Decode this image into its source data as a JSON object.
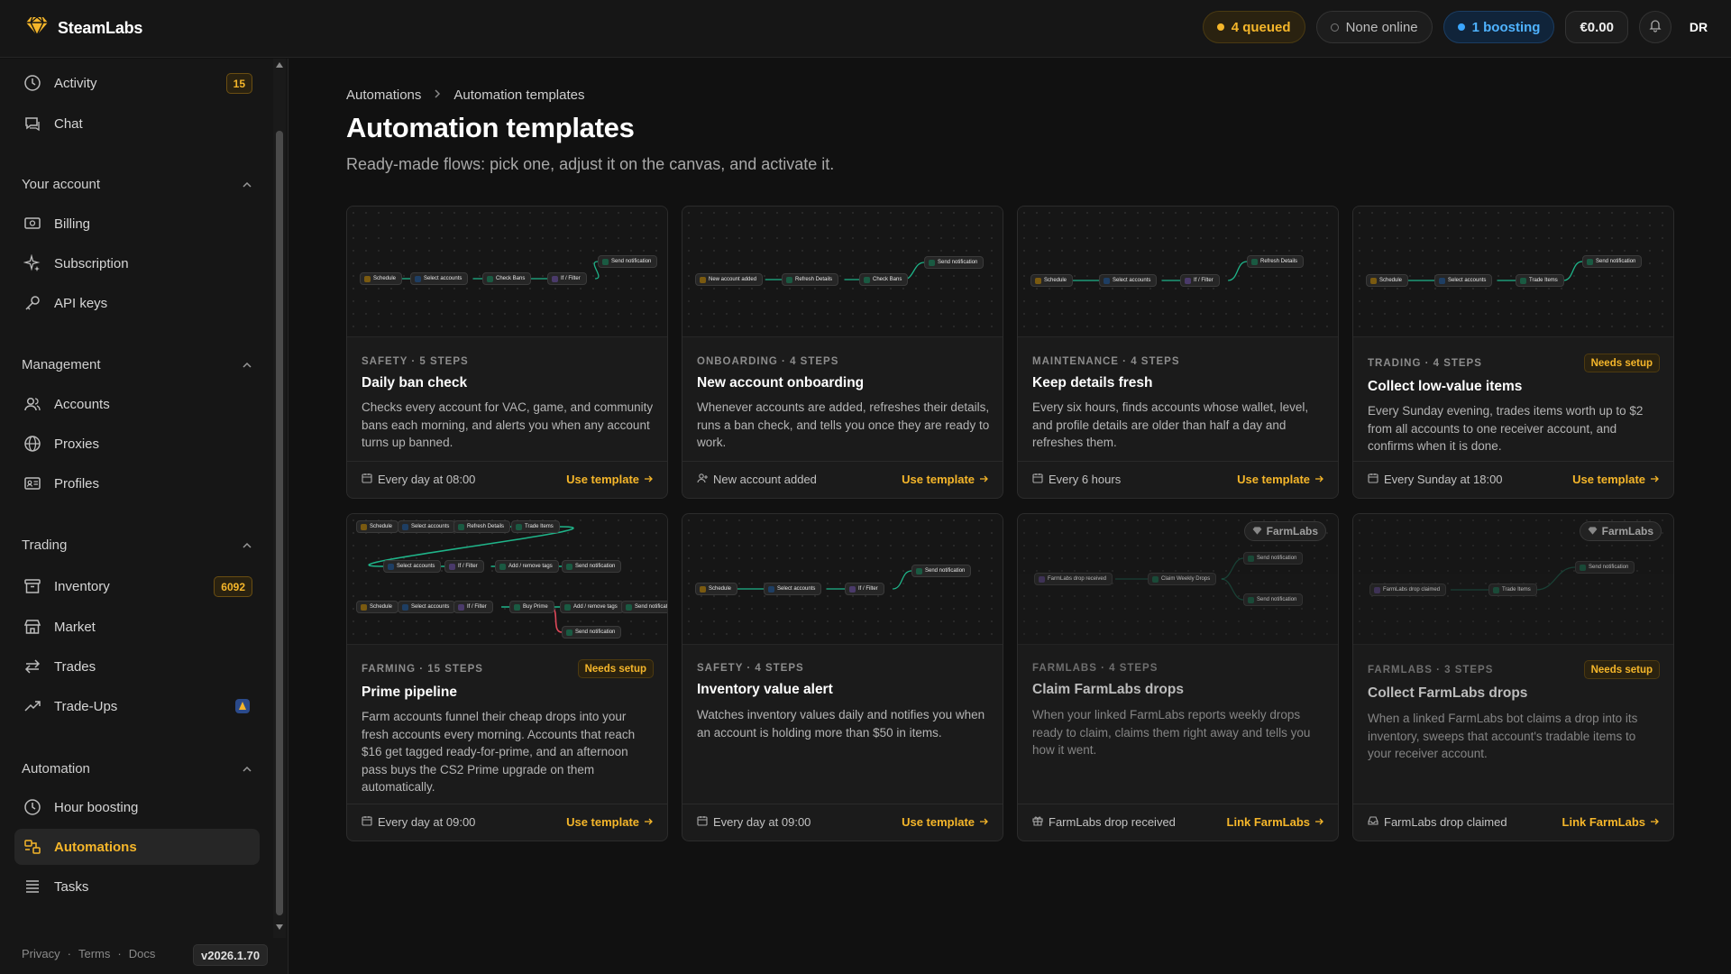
{
  "brand": {
    "name": "SteamLabs",
    "logo_icon": "diamond-logo-icon"
  },
  "topbar": {
    "queued": "4 queued",
    "online": "None online",
    "boosting": "1 boosting",
    "balance": "€0.00",
    "avatar_initials": "DR"
  },
  "sidebar": {
    "top_items": [
      {
        "label": "Activity",
        "icon": "clock-icon",
        "badge": "15"
      },
      {
        "label": "Chat",
        "icon": "chat-icon"
      }
    ],
    "sections": [
      {
        "title": "Your account",
        "items": [
          {
            "label": "Billing",
            "icon": "billing-icon"
          },
          {
            "label": "Subscription",
            "icon": "sparkle-icon"
          },
          {
            "label": "API keys",
            "icon": "key-icon"
          }
        ]
      },
      {
        "title": "Management",
        "items": [
          {
            "label": "Accounts",
            "icon": "users-icon"
          },
          {
            "label": "Proxies",
            "icon": "globe-icon"
          },
          {
            "label": "Profiles",
            "icon": "id-card-icon"
          }
        ]
      },
      {
        "title": "Trading",
        "items": [
          {
            "label": "Inventory",
            "icon": "archive-icon",
            "badge": "6092"
          },
          {
            "label": "Market",
            "icon": "store-icon"
          },
          {
            "label": "Trades",
            "icon": "swap-icon"
          },
          {
            "label": "Trade-Ups",
            "icon": "trending-up-icon"
          }
        ]
      },
      {
        "title": "Automation",
        "items": [
          {
            "label": "Hour boosting",
            "icon": "clock-icon"
          },
          {
            "label": "Automations",
            "icon": "automation-icon",
            "active": true
          },
          {
            "label": "Tasks",
            "icon": "list-icon"
          }
        ]
      }
    ],
    "footer": {
      "privacy": "Privacy",
      "terms": "Terms",
      "docs": "Docs",
      "version": "v2026.1.70"
    }
  },
  "main": {
    "breadcrumb": [
      "Automations",
      "Automation templates"
    ],
    "title": "Automation templates",
    "subtitle": "Ready-made flows: pick one, adjust it on the canvas, and activate it.",
    "cards": [
      {
        "meta": "SAFETY · 5 STEPS",
        "title": "Daily ban check",
        "desc": "Checks every account for VAC, game, and community bans each morning, and alerts you when any account turns up banned.",
        "trigger": "Every day at 08:00",
        "trigger_icon": "calendar-icon",
        "action": "Use template",
        "nodes": [
          "Schedule",
          "Select accounts",
          "Check Bans",
          "If / Filter",
          "Send notification"
        ]
      },
      {
        "meta": "ONBOARDING · 4 STEPS",
        "title": "New account onboarding",
        "desc": "Whenever accounts are added, refreshes their details, runs a ban check, and tells you once they are ready to work.",
        "trigger": "New account added",
        "trigger_icon": "user-plus-icon",
        "action": "Use template",
        "nodes": [
          "New account added",
          "Refresh Details",
          "Check Bans",
          "Send notification"
        ]
      },
      {
        "meta": "MAINTENANCE · 4 STEPS",
        "title": "Keep details fresh",
        "desc": "Every six hours, finds accounts whose wallet, level, and profile details are older than half a day and refreshes them.",
        "trigger": "Every 6 hours",
        "trigger_icon": "calendar-icon",
        "action": "Use template",
        "nodes": [
          "Schedule",
          "Select accounts",
          "If / Filter",
          "Refresh Details"
        ]
      },
      {
        "meta": "TRADING · 4 STEPS",
        "title": "Collect low-value items",
        "needs_setup": "Needs setup",
        "desc": "Every Sunday evening, trades items worth up to $2 from all accounts to one receiver account, and confirms when it is done.",
        "trigger": "Every Sunday at 18:00",
        "trigger_icon": "calendar-icon",
        "action": "Use template",
        "nodes": [
          "Schedule",
          "Select accounts",
          "Trade Items",
          "Send notification"
        ]
      },
      {
        "meta": "FARMING · 15 STEPS",
        "title": "Prime pipeline",
        "needs_setup": "Needs setup",
        "desc": "Farm accounts funnel their cheap drops into your fresh accounts every morning. Accounts that reach $16 get tagged ready-for-prime, and an afternoon pass buys the CS2 Prime upgrade on them automatically.",
        "trigger": "Every day at 09:00",
        "trigger_icon": "calendar-icon",
        "action": "Use template",
        "nodes": [
          "Schedule",
          "Select accounts",
          "Refresh Details",
          "Trade Items",
          "Select accounts",
          "If / Filter",
          "Add / remove tags",
          "Send notification",
          "Schedule",
          "Select accounts",
          "If / Filter",
          "Buy Prime",
          "Add / remove tags",
          "Send notification",
          "Send notification"
        ]
      },
      {
        "meta": "SAFETY · 4 STEPS",
        "title": "Inventory value alert",
        "desc": "Watches inventory values daily and notifies you when an account is holding more than $50 in items.",
        "trigger": "Every day at 09:00",
        "trigger_icon": "calendar-icon",
        "action": "Use template",
        "nodes": [
          "Schedule",
          "Select accounts",
          "If / Filter",
          "Send notification"
        ]
      },
      {
        "meta": "FARMLABS · 4 STEPS",
        "title": "Claim FarmLabs drops",
        "chip": "FarmLabs",
        "desc": "When your linked FarmLabs reports weekly drops ready to claim, claims them right away and tells you how it went.",
        "trigger": "FarmLabs drop received",
        "trigger_icon": "gift-icon",
        "action": "Link FarmLabs",
        "nodes": [
          "FarmLabs drop received",
          "Claim Weekly Drops",
          "Send notification",
          "Send notification"
        ]
      },
      {
        "meta": "FARMLABS · 3 STEPS",
        "title": "Collect FarmLabs drops",
        "chip": "FarmLabs",
        "needs_setup": "Needs setup",
        "desc": "When a linked FarmLabs bot claims a drop into its inventory, sweeps that account's tradable items to your receiver account.",
        "trigger": "FarmLabs drop claimed",
        "trigger_icon": "inbox-icon",
        "action": "Link FarmLabs",
        "nodes": [
          "FarmLabs drop claimed",
          "Trade Items",
          "Send notification"
        ]
      }
    ]
  },
  "colors": {
    "accent": "#f5b62a",
    "wire": "#1fb489",
    "wire_error": "#e0485a",
    "boost": "#3ba7ff",
    "background": "#111111"
  }
}
